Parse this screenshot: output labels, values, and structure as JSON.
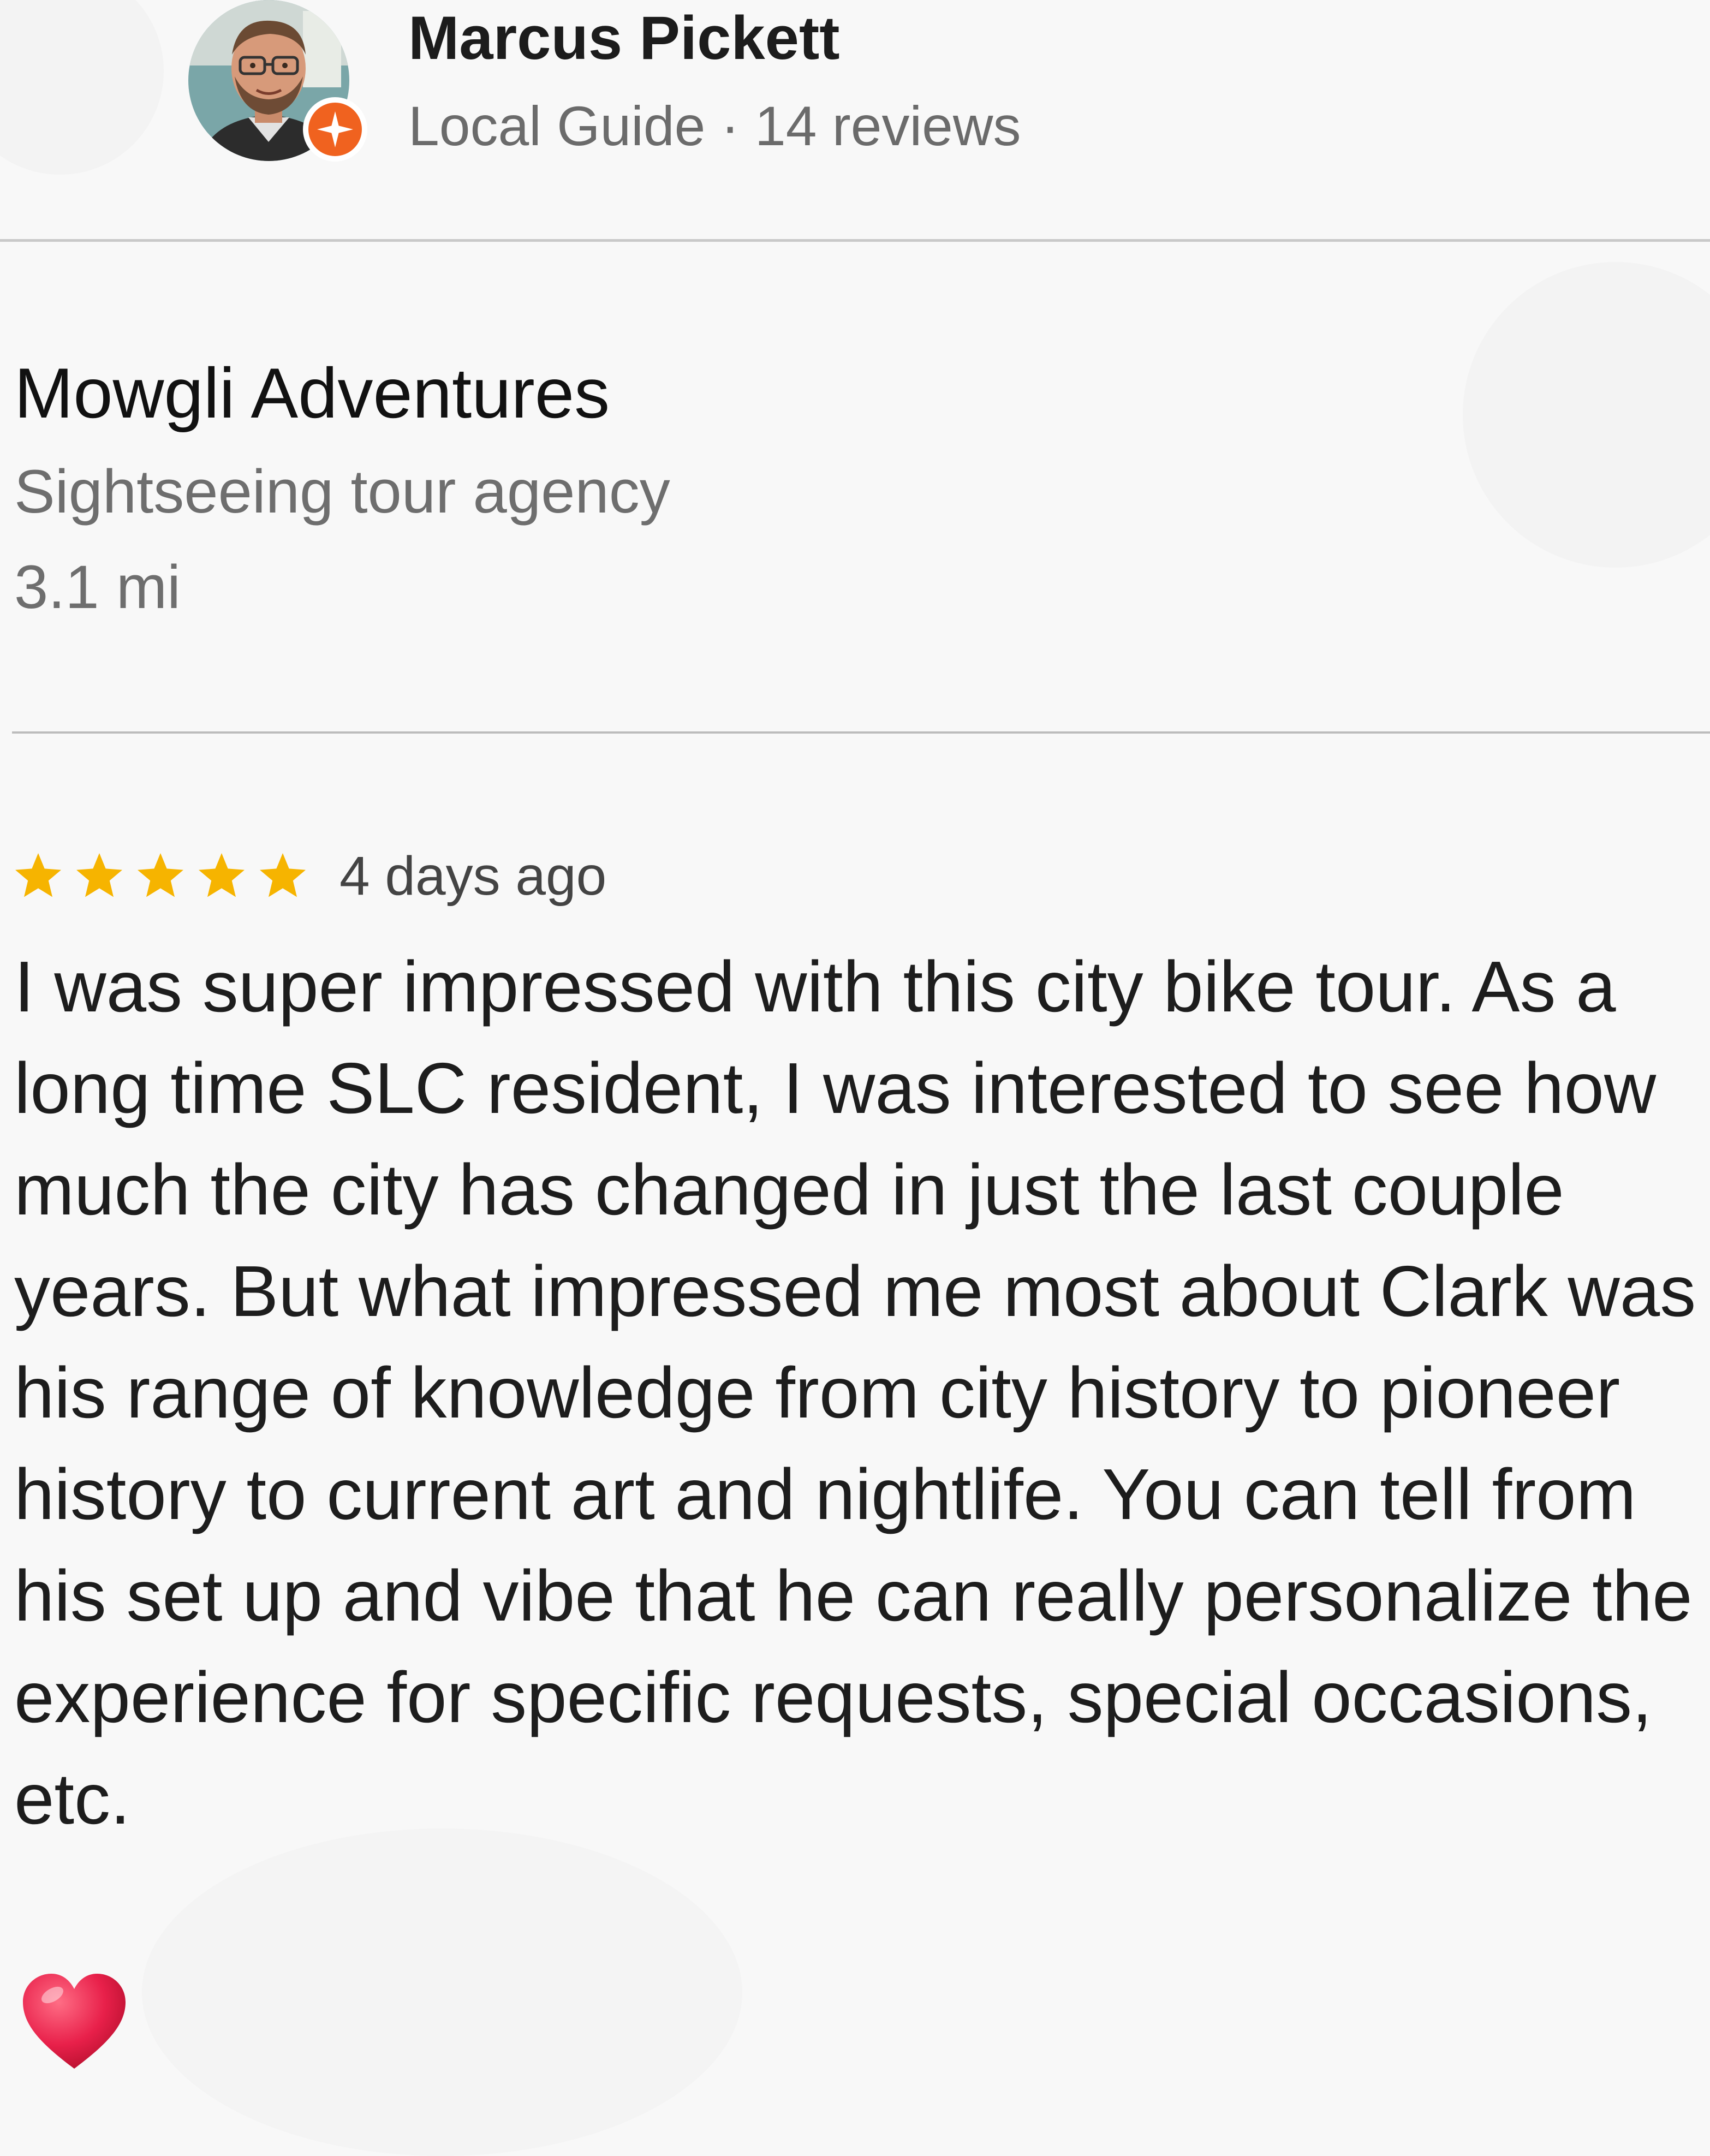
{
  "reviewer": {
    "name": "Marcus Pickett",
    "meta": "Local Guide · 14 reviews",
    "badge_icon": "local-guide-star-badge",
    "badge_color": "#f0621f"
  },
  "place": {
    "name": "Mowgli Adventures",
    "category": "Sightseeing tour agency",
    "distance": "3.1 mi"
  },
  "review": {
    "rating": 5,
    "rating_max": 5,
    "star_color": "#f6b400",
    "date": "4 days ago",
    "text": "I was super impressed with this city bike tour. As a long time SLC resident, I was interested to see how much the city has changed in just the last couple years. But what impressed me most about Clark was his range of knowledge from city history to pioneer history to current art and nightlife. You can tell from his set up and vibe that he can really personalize the experience for specific requests, special occasions, etc."
  },
  "reaction": {
    "icon": "heart-icon",
    "color": "#e8204a"
  }
}
